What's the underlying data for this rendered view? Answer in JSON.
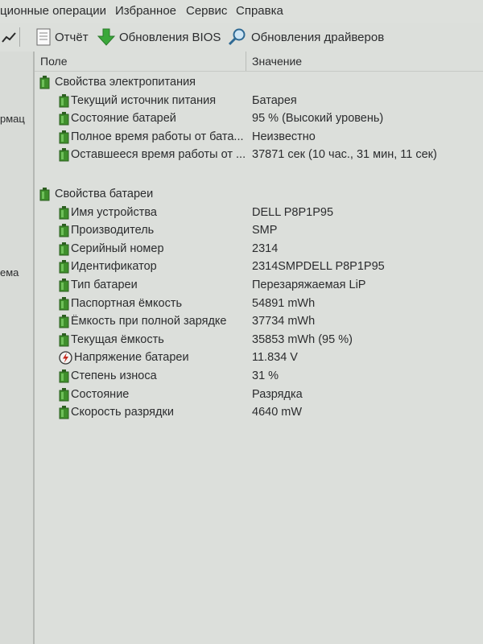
{
  "menu": {
    "items": [
      "ционные операции",
      "Избранное",
      "Сервис",
      "Справка"
    ]
  },
  "toolbar": {
    "report_label": "Отчёт",
    "bios_label": "Обновления BIOS",
    "drivers_label": "Обновления драйверов"
  },
  "left_panel": {
    "items": [
      "рмац",
      "ема"
    ]
  },
  "table": {
    "col_field": "Поле",
    "col_value": "Значение",
    "groups": [
      {
        "title": "Свойства электропитания",
        "rows": [
          {
            "field": "Текущий источник питания",
            "value": "Батарея"
          },
          {
            "field": "Состояние батарей",
            "value": "95 % (Высокий уровень)"
          },
          {
            "field": "Полное время работы от бата...",
            "value": "Неизвестно"
          },
          {
            "field": "Оставшееся время работы от ...",
            "value": "37871 сек (10 час., 31 мин, 11 сек)"
          }
        ]
      },
      {
        "title": "Свойства батареи",
        "rows": [
          {
            "field": "Имя устройства",
            "value": "DELL P8P1P95"
          },
          {
            "field": "Производитель",
            "value": "SMP"
          },
          {
            "field": "Серийный номер",
            "value": "2314"
          },
          {
            "field": "Идентификатор",
            "value": "2314SMPDELL P8P1P95"
          },
          {
            "field": "Тип батареи",
            "value": "Перезаряжаемая LiP"
          },
          {
            "field": "Паспортная ёмкость",
            "value": "54891 mWh"
          },
          {
            "field": "Ёмкость при полной зарядке",
            "value": "37734 mWh"
          },
          {
            "field": "Текущая ёмкость",
            "value": "35853 mWh  (95 %)"
          },
          {
            "field": "Напряжение батареи",
            "value": "11.834 V"
          },
          {
            "field": "Степень износа",
            "value": "31 %"
          },
          {
            "field": "Состояние",
            "value": "Разрядка"
          },
          {
            "field": "Скорость разрядки",
            "value": "4640 mW"
          }
        ]
      }
    ]
  },
  "icons": {
    "battery": "battery-icon",
    "voltage": "voltage-icon",
    "report": "report-icon",
    "bios": "download-arrow-icon",
    "drivers": "magnifier-icon"
  },
  "colors": {
    "battery_green": "#3f8f2c",
    "battery_dark": "#2c5f20",
    "arrow_green": "#3aa83a"
  }
}
